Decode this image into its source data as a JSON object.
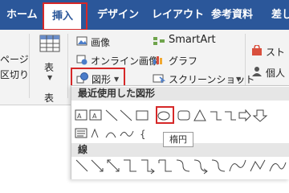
{
  "tabs": [
    {
      "label": "ホーム"
    },
    {
      "label": "挿入"
    },
    {
      "label": "デザイン"
    },
    {
      "label": "レイアウト"
    },
    {
      "label": "参考資料"
    },
    {
      "label": "差し"
    }
  ],
  "ribbon": {
    "pages_label_1": "ページ",
    "pages_label_2": "区切り",
    "table_label": "表",
    "table_group": "表",
    "image_label": "画像",
    "online_image_label": "オンライン画像",
    "shapes_label": "図形",
    "smartart_label": "SmartArt",
    "graph_label": "グラフ",
    "screenshot_label": "スクリーンショット",
    "store_label": "スト",
    "personal_label": "個人"
  },
  "shapes_panel": {
    "recent_header": "最近使用した図形",
    "lines_header": "線"
  },
  "tooltip": {
    "text": "楕円"
  },
  "colors": {
    "brand": "#2b579a",
    "highlight": "#d62828"
  }
}
